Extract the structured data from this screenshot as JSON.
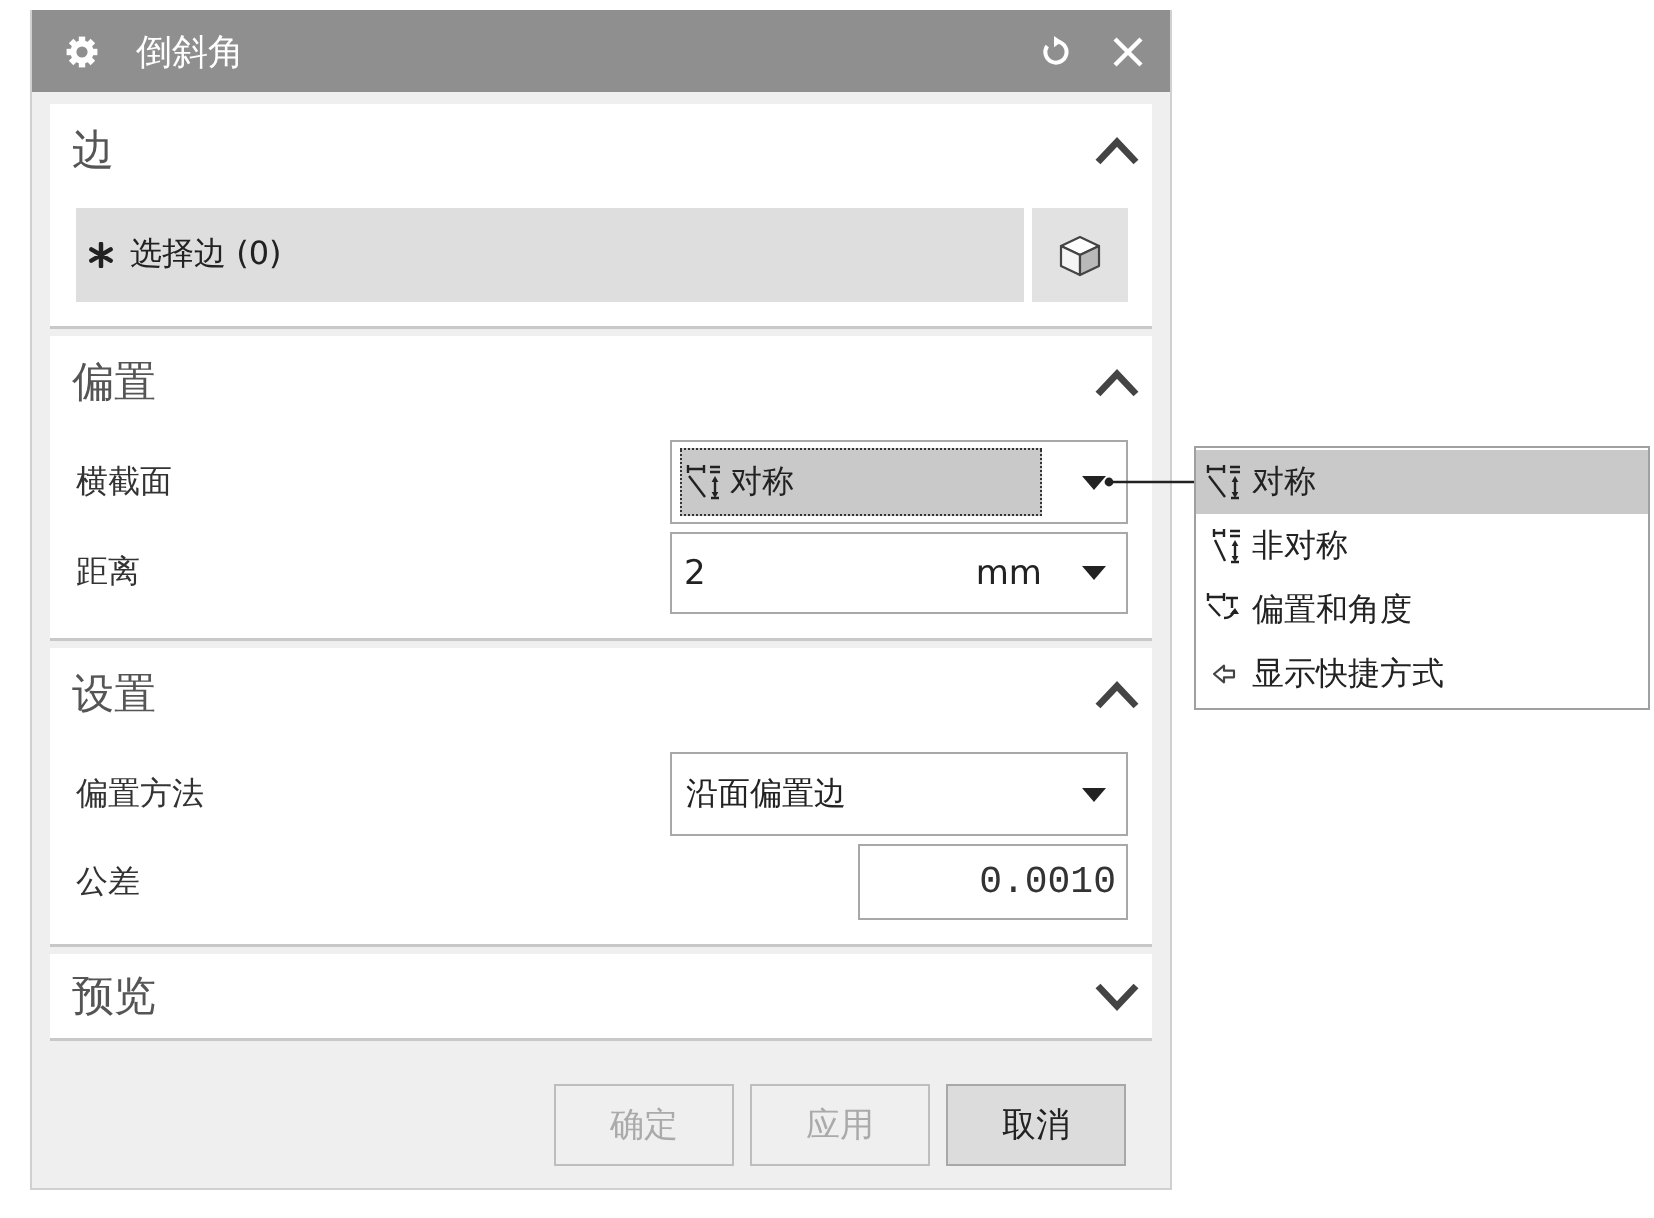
{
  "window": {
    "title": "倒斜角"
  },
  "sections": [
    {
      "title": "边",
      "expanded": true,
      "rows": [
        {
          "kind": "selection",
          "label": "选择边 (0)"
        }
      ]
    },
    {
      "title": "偏置",
      "expanded": true,
      "rows": [
        {
          "kind": "dropdown",
          "label": "横截面",
          "value": "对称",
          "focused": true,
          "open": true,
          "options": [
            {
              "kind": "symmetric",
              "label": "对称",
              "selected": true
            },
            {
              "kind": "asymmetric",
              "label": "非对称",
              "selected": false
            },
            {
              "kind": "offset_angle",
              "label": "偏置和角度",
              "selected": false
            },
            {
              "kind": "shortcut",
              "label": "显示快捷方式",
              "selected": false
            }
          ]
        },
        {
          "kind": "unit_field",
          "label": "距离",
          "value": "2",
          "unit": "mm"
        }
      ]
    },
    {
      "title": "设置",
      "expanded": true,
      "rows": [
        {
          "kind": "dropdown",
          "label": "偏置方法",
          "value": "沿面偏置边",
          "focused": false
        },
        {
          "kind": "number",
          "label": "公差",
          "value": "0.0010"
        }
      ]
    },
    {
      "title": "预览",
      "expanded": false
    }
  ],
  "buttons": [
    {
      "label": "确定",
      "disabled": true
    },
    {
      "label": "应用",
      "disabled": true
    },
    {
      "label": "取消",
      "disabled": false
    }
  ]
}
